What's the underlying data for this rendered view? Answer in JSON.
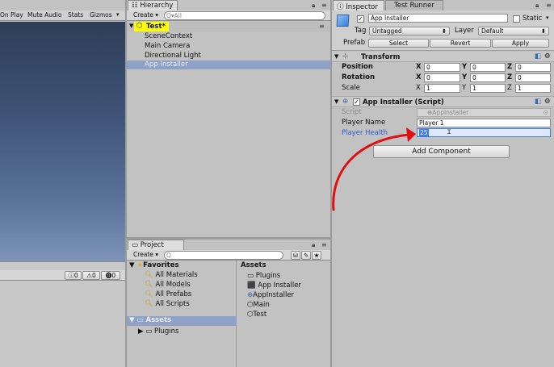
{
  "game_toolbar": {
    "on_play": "On Play",
    "mute_audio": "Mute Audio",
    "stats": "Stats",
    "gizmos": "Gizmos"
  },
  "hierarchy": {
    "tab": "Hierarchy",
    "create": "Create",
    "search_placeholder": "Q▾All",
    "scene": "Test*",
    "items": [
      "SceneContext",
      "Main Camera",
      "Directional Light",
      "App Installer"
    ]
  },
  "console": {
    "info_count": "0",
    "warn_count": "0",
    "error_count": "0"
  },
  "project": {
    "tab": "Project",
    "create": "Create",
    "favorites_label": "Favorites",
    "favorites": [
      "All Materials",
      "All Models",
      "All Prefabs",
      "All Scripts"
    ],
    "assets_root": "Assets",
    "tree_children": [
      "Plugins"
    ],
    "assets_header": "Assets",
    "assets": [
      "Plugins",
      "App Installer",
      "AppInstaller",
      "Main",
      "Test"
    ]
  },
  "inspector": {
    "tab": "Inspector",
    "tab2": "Test Runner",
    "object_name": "App Installer",
    "static_label": "Static",
    "tag_label": "Tag",
    "tag_value": "Untagged",
    "layer_label": "Layer",
    "layer_value": "Default",
    "prefab_label": "Prefab",
    "prefab_select": "Select",
    "prefab_revert": "Revert",
    "prefab_apply": "Apply",
    "transform": {
      "title": "Transform",
      "rows": [
        {
          "label": "Position",
          "x": "0",
          "y": "0",
          "z": "0"
        },
        {
          "label": "Rotation",
          "x": "0",
          "y": "0",
          "z": "0"
        },
        {
          "label": "Scale",
          "x": "1",
          "y": "1",
          "z": "1"
        }
      ],
      "x": "X",
      "y": "Y",
      "z": "Z"
    },
    "component": {
      "title": "App Installer (Script)",
      "script_label": "Script",
      "script_value": "AppInstaller",
      "player_name_label": "Player Name",
      "player_name_value": "Player 1",
      "player_health_label": "Player Health",
      "player_health_value": "25"
    },
    "add_component": "Add Component"
  },
  "colors": {
    "selection": "#3e7de6",
    "highlight": "#ffff00",
    "arrow": "#e01010"
  }
}
